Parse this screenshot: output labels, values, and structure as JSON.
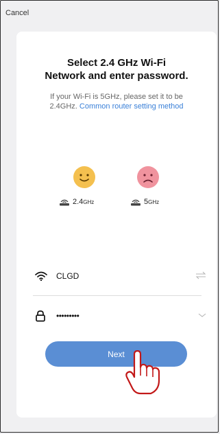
{
  "header": {
    "cancel_label": "Cancel"
  },
  "card": {
    "title_line1": "Select 2.4 GHz Wi-Fi",
    "title_line2": "Network and enter password.",
    "hint_line1": "If your Wi-Fi is 5GHz, please set it to be",
    "hint_line2_prefix": "2.4GHz.",
    "hint_link": "Common router setting method"
  },
  "bands": [
    {
      "label": "2.4",
      "unit": "GHz",
      "face": "happy-face-icon"
    },
    {
      "label": "5",
      "unit": "GHz",
      "face": "sad-face-icon"
    }
  ],
  "wifi": {
    "ssid": "CLGD",
    "icon": "wifi-icon",
    "action_icon": "swap-icon"
  },
  "password": {
    "value": "•••••••••",
    "icon": "lock-icon",
    "action_icon": "chevron-down-icon"
  },
  "actions": {
    "next_label": "Next"
  },
  "colors": {
    "accent": "#5a8ed4",
    "link": "#3a80d8",
    "happy": "#f4c04f",
    "sad": "#f0939e"
  }
}
